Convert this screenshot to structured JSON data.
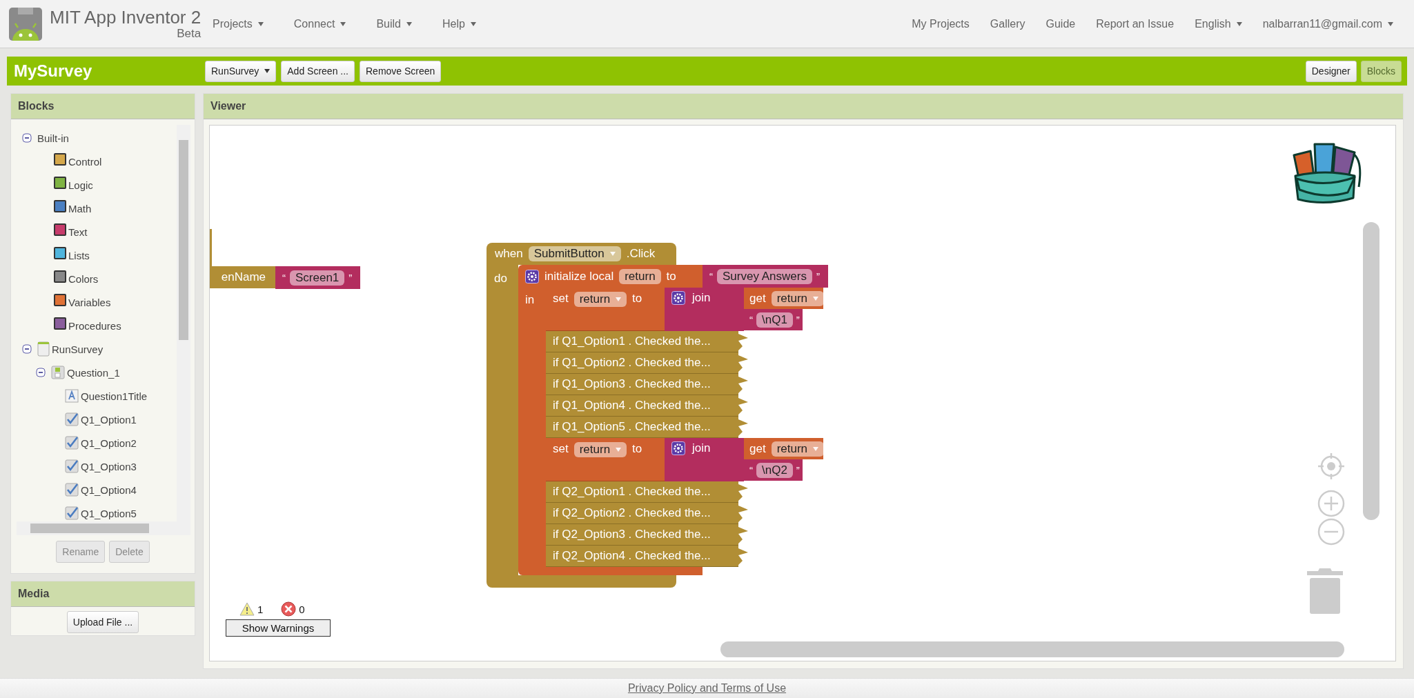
{
  "header": {
    "app_name": "MIT App Inventor 2",
    "edition": "Beta",
    "menus": [
      "Projects",
      "Connect",
      "Build",
      "Help"
    ],
    "links": [
      "My Projects",
      "Gallery",
      "Guide",
      "Report an Issue"
    ],
    "language": "English",
    "account": "nalbarran11@gmail.com"
  },
  "project_bar": {
    "title": "MySurvey",
    "screen_select": "RunSurvey",
    "buttons": [
      "Add Screen ...",
      "Remove Screen"
    ],
    "modes": [
      {
        "label": "Designer",
        "selected": false
      },
      {
        "label": "Blocks",
        "selected": true
      }
    ]
  },
  "blocks_panel": {
    "title": "Blocks",
    "tree": [
      {
        "label": "Built-in",
        "kind": "group",
        "expanded": true,
        "children": [
          {
            "label": "Control",
            "color": "#d5a84b"
          },
          {
            "label": "Logic",
            "color": "#7fb343"
          },
          {
            "label": "Math",
            "color": "#4a7fc1"
          },
          {
            "label": "Text",
            "color": "#c73c6b"
          },
          {
            "label": "Lists",
            "color": "#4fb5dd"
          },
          {
            "label": "Colors",
            "color": "#888888"
          },
          {
            "label": "Variables",
            "color": "#e07236"
          },
          {
            "label": "Procedures",
            "color": "#8a5e9c"
          }
        ]
      },
      {
        "label": "RunSurvey",
        "kind": "screen",
        "expanded": true,
        "children": [
          {
            "label": "Question_1",
            "kind": "arrangement",
            "expanded": true,
            "children": [
              {
                "label": "Question1Title",
                "kind": "label"
              },
              {
                "label": "Q1_Option1",
                "kind": "checkbox"
              },
              {
                "label": "Q1_Option2",
                "kind": "checkbox"
              },
              {
                "label": "Q1_Option3",
                "kind": "checkbox"
              },
              {
                "label": "Q1_Option4",
                "kind": "checkbox"
              },
              {
                "label": "Q1_Option5",
                "kind": "checkbox"
              }
            ]
          }
        ]
      }
    ],
    "buttons": [
      {
        "label": "Rename",
        "disabled": true
      },
      {
        "label": "Delete",
        "disabled": true
      }
    ]
  },
  "media_panel": {
    "title": "Media",
    "button": "Upload File ..."
  },
  "viewer": {
    "title": "Viewer",
    "partial_block": {
      "label": "enName",
      "text": {
        "open": "“",
        "value": "Screen1",
        "close": "”"
      }
    },
    "event_block": {
      "keyword": "when",
      "component": "SubmitButton",
      "event": ".Click",
      "do_label": "do",
      "local": {
        "keyword": "initialize local",
        "name": "return",
        "to": "to",
        "value": {
          "open": "“",
          "value": "Survey Answers",
          "close": "”"
        },
        "in_label": "in",
        "statements": [
          {
            "kind": "set",
            "keyword": "set",
            "variable": "return",
            "to": "to",
            "join": "join",
            "get": "get",
            "get_variable": "return",
            "text": {
              "open": "“",
              "value": "\\nQ1",
              "close": "”"
            }
          },
          {
            "kind": "collapsed",
            "label": "if Q1_Option1 . Checked the..."
          },
          {
            "kind": "collapsed",
            "label": "if Q1_Option2 . Checked the..."
          },
          {
            "kind": "collapsed",
            "label": "if Q1_Option3 . Checked the..."
          },
          {
            "kind": "collapsed",
            "label": "if Q1_Option4 . Checked the..."
          },
          {
            "kind": "collapsed",
            "label": "if Q1_Option5 . Checked the..."
          },
          {
            "kind": "set",
            "keyword": "set",
            "variable": "return",
            "to": "to",
            "join": "join",
            "get": "get",
            "get_variable": "return",
            "text": {
              "open": "“",
              "value": "\\nQ2",
              "close": "”"
            }
          },
          {
            "kind": "collapsed",
            "label": "if Q2_Option1 . Checked the..."
          },
          {
            "kind": "collapsed",
            "label": "if Q2_Option2 . Checked the..."
          },
          {
            "kind": "collapsed",
            "label": "if Q2_Option3 . Checked the..."
          },
          {
            "kind": "collapsed",
            "label": "if Q2_Option4 . Checked the..."
          }
        ]
      }
    },
    "warning_count": "1",
    "error_count": "0",
    "warnings_button": "Show Warnings"
  },
  "footer": {
    "link": "Privacy Policy and Terms of Use"
  }
}
